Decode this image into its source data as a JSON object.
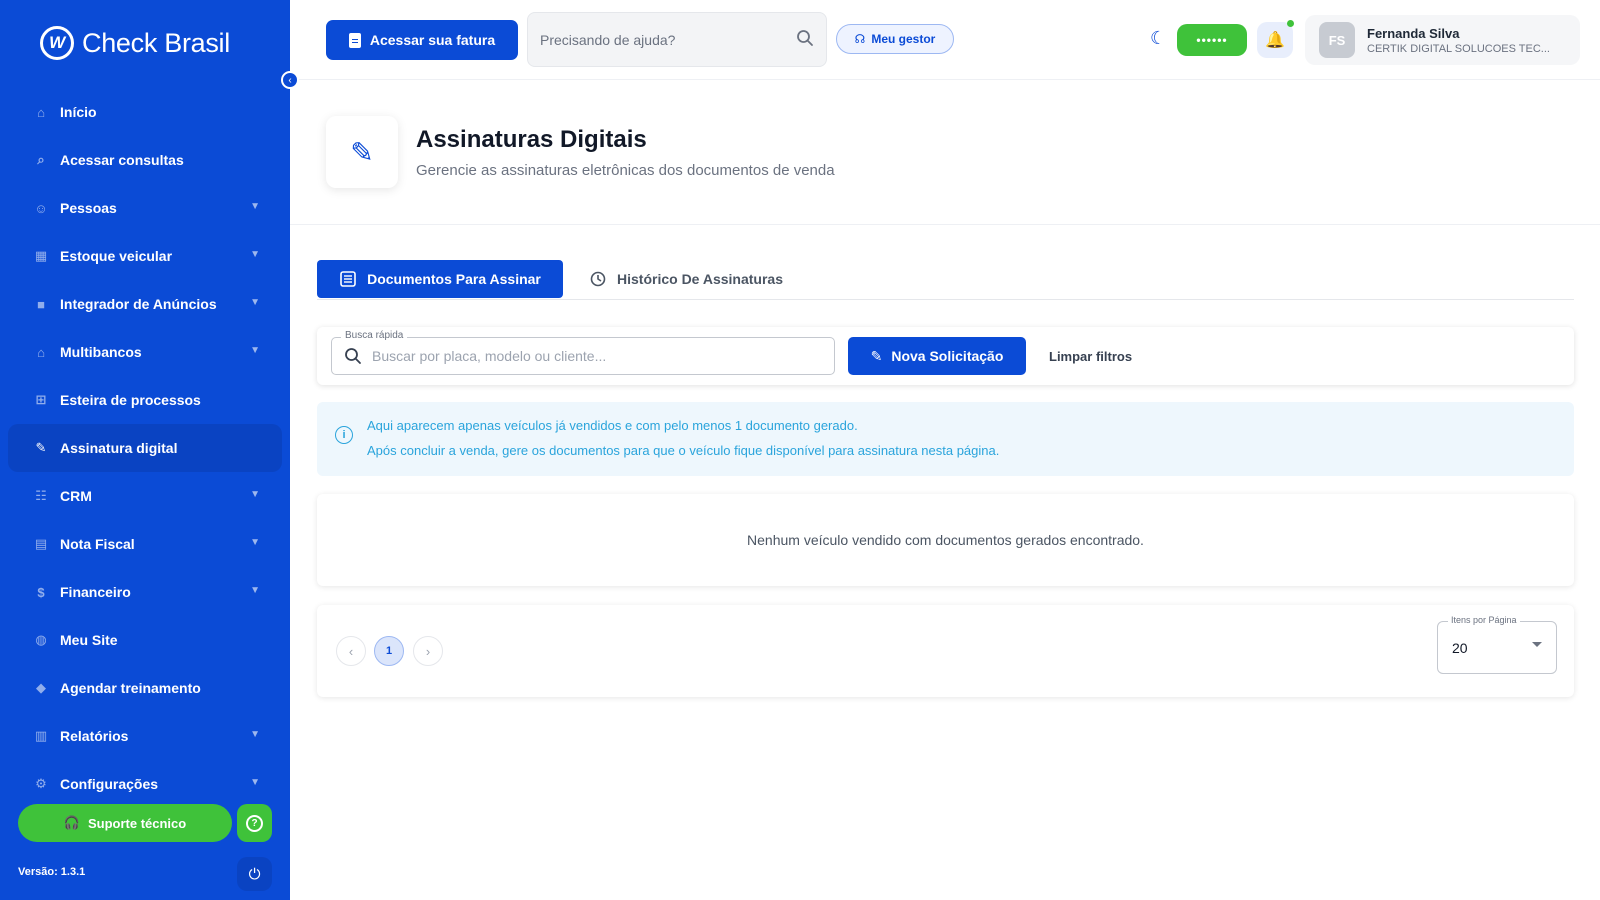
{
  "app": {
    "brand": "Check Brasil",
    "version": "Versão: 1.3.1"
  },
  "sidebar": {
    "items": [
      {
        "label": "Início",
        "icon": "home-icon",
        "has_submenu": false
      },
      {
        "label": "Acessar consultas",
        "icon": "search-icon",
        "has_submenu": false
      },
      {
        "label": "Pessoas",
        "icon": "users-icon",
        "has_submenu": true
      },
      {
        "label": "Estoque veicular",
        "icon": "warehouse-icon",
        "has_submenu": true
      },
      {
        "label": "Integrador de Anúncios",
        "icon": "ads-icon",
        "has_submenu": true
      },
      {
        "label": "Multibancos",
        "icon": "bank-icon",
        "has_submenu": true
      },
      {
        "label": "Esteira de processos",
        "icon": "workflow-icon",
        "has_submenu": false
      },
      {
        "label": "Assinatura digital",
        "icon": "signature-icon",
        "has_submenu": false,
        "active": true
      },
      {
        "label": "CRM",
        "icon": "crm-icon",
        "has_submenu": true
      },
      {
        "label": "Nota Fiscal",
        "icon": "invoice-icon",
        "has_submenu": true
      },
      {
        "label": "Financeiro",
        "icon": "money-icon",
        "has_submenu": true
      },
      {
        "label": "Meu Site",
        "icon": "globe-icon",
        "has_submenu": false
      },
      {
        "label": "Agendar treinamento",
        "icon": "graduation-icon",
        "has_submenu": false
      },
      {
        "label": "Relatórios",
        "icon": "report-icon",
        "has_submenu": true
      },
      {
        "label": "Configurações",
        "icon": "gear-icon",
        "has_submenu": true
      }
    ],
    "support_label": "Suporte técnico"
  },
  "topbar": {
    "fatura_label": "Acessar sua fatura",
    "help_placeholder": "Precisando de ajuda?",
    "gestor_label": "Meu gestor",
    "masked_pill": "••••••",
    "user": {
      "initials": "FS",
      "name": "Fernanda Silva",
      "company": "CERTIK DIGITAL SOLUCOES TEC..."
    }
  },
  "page": {
    "title": "Assinaturas Digitais",
    "subtitle": "Gerencie as assinaturas eletrônicas dos documentos de venda"
  },
  "tabs": [
    {
      "label": "Documentos Para Assinar",
      "active": true
    },
    {
      "label": "Histórico De Assinaturas",
      "active": false
    }
  ],
  "filters": {
    "search_legend": "Busca rápida",
    "search_placeholder": "Buscar por placa, modelo ou cliente...",
    "nova_label": "Nova Solicitação",
    "limpar_label": "Limpar filtros"
  },
  "info": {
    "line1": "Aqui aparecem apenas veículos já vendidos e com pelo menos 1 documento gerado.",
    "line2": "Após concluir a venda, gere os documentos para que o veículo fique disponível para assinatura nesta página."
  },
  "empty_message": "Nenhum veículo vendido com documentos gerados encontrado.",
  "pagination": {
    "current_page": "1",
    "items_legend": "Itens por Página",
    "items_per_page": "20"
  },
  "colors": {
    "primary": "#0b4bd6",
    "success": "#3fc23a",
    "info": "#2aa4dc"
  }
}
